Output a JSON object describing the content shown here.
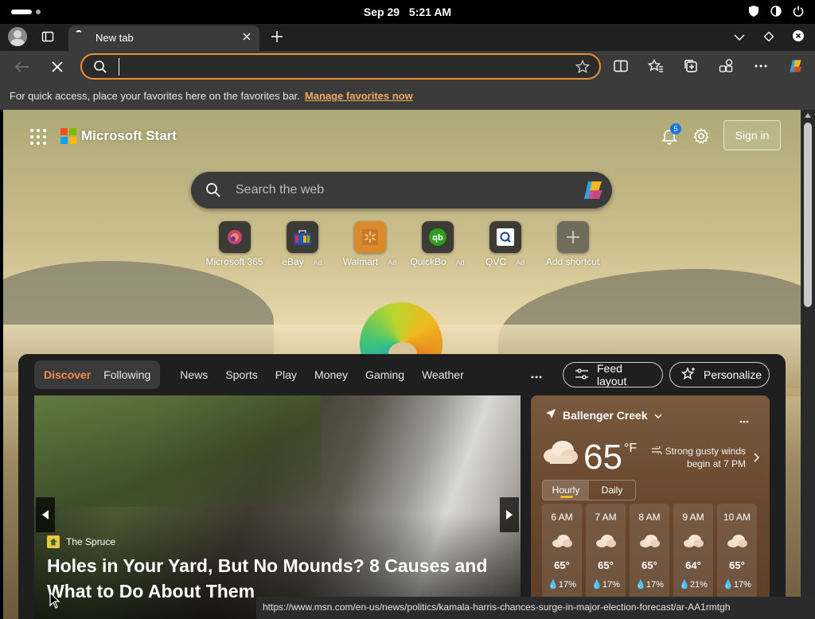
{
  "os": {
    "date": "Sep 29",
    "time": "5:21 AM"
  },
  "tab": {
    "title": "New tab"
  },
  "address": {
    "value": "",
    "placeholder": ""
  },
  "favorites_bar": {
    "message": "For quick access, place your favorites here on the favorites bar.",
    "link": "Manage favorites now"
  },
  "start": {
    "brand": "Microsoft Start",
    "notification_count": "5",
    "sign_in": "Sign in",
    "search_placeholder": "Search the web",
    "shortcuts": [
      {
        "label": "Microsoft 365",
        "ad": ""
      },
      {
        "label": "eBay",
        "ad": "Ad"
      },
      {
        "label": "Walmart",
        "ad": "Ad"
      },
      {
        "label": "QuickBo",
        "ad": "Ad"
      },
      {
        "label": "QVC",
        "ad": "Ad"
      },
      {
        "label": "Add shortcut",
        "ad": ""
      }
    ]
  },
  "feed": {
    "pills": [
      "Discover",
      "Following"
    ],
    "links": [
      "News",
      "Sports",
      "Play",
      "Money",
      "Gaming",
      "Weather"
    ],
    "feed_layout": "Feed layout",
    "personalize": "Personalize",
    "hero": {
      "source": "The Spruce",
      "headline": "Holes in Your Yard, But No Mounds? 8 Causes and What to Do About Them"
    }
  },
  "weather": {
    "location": "Ballenger Creek",
    "temp": "65",
    "unit": "°F",
    "alert_line1": "Strong gusty winds",
    "alert_line2": "begin at 7 PM",
    "tabs": [
      "Hourly",
      "Daily"
    ],
    "hours": [
      {
        "time": "6 AM",
        "temp": "65°",
        "precip": "17%"
      },
      {
        "time": "7 AM",
        "temp": "65°",
        "precip": "17%"
      },
      {
        "time": "8 AM",
        "temp": "65°",
        "precip": "17%"
      },
      {
        "time": "9 AM",
        "temp": "64°",
        "precip": "21%"
      },
      {
        "time": "10 AM",
        "temp": "65°",
        "precip": "17%"
      }
    ]
  },
  "status_url": "https://www.msn.com/en-us/news/politics/kamala-harris-chances-surge-in-major-election-forecast/ar-AA1rmtgh",
  "colors": {
    "accent": "#e8913a",
    "link": "#f1a95b",
    "discover": "#f28c55"
  }
}
